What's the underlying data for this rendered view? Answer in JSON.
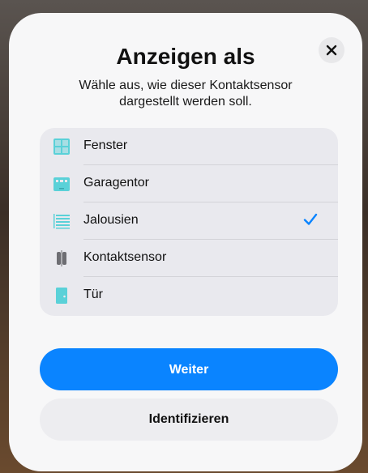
{
  "dialog": {
    "title": "Anzeigen als",
    "subtitle": "Wähle aus, wie dieser Kontaktsensor dargestellt werden soll."
  },
  "options": [
    {
      "label": "Fenster",
      "icon": "window-icon",
      "selected": false
    },
    {
      "label": "Garagentor",
      "icon": "garage-door-icon",
      "selected": false
    },
    {
      "label": "Jalousien",
      "icon": "blinds-icon",
      "selected": true
    },
    {
      "label": "Kontaktsensor",
      "icon": "contact-sensor-icon",
      "selected": false
    },
    {
      "label": "Tür",
      "icon": "door-icon",
      "selected": false
    }
  ],
  "buttons": {
    "primary_label": "Weiter",
    "secondary_label": "Identifizieren"
  },
  "colors": {
    "accent": "#0a84ff",
    "icon_teal": "#5ad1d8",
    "icon_gray": "#6e6e73"
  }
}
